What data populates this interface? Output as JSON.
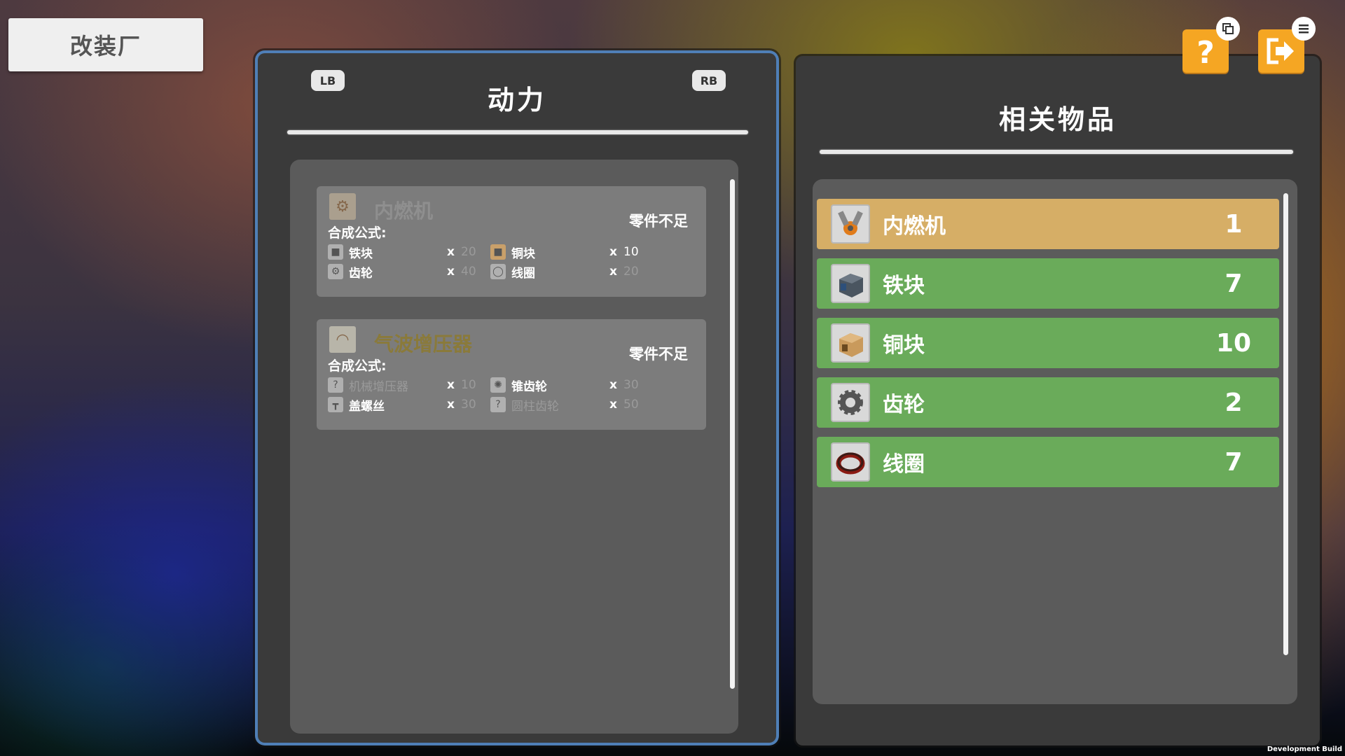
{
  "app": {
    "title": "改装厂"
  },
  "left_panel": {
    "prev_button": "LB",
    "next_button": "RB",
    "category": "动力",
    "recipes": [
      {
        "name": "内燃机",
        "status": "零件不足",
        "formula_label": "合成公式:",
        "ingredients": [
          {
            "name": "铁块",
            "x": "x",
            "qty": "20"
          },
          {
            "name": "铜块",
            "x": "x",
            "qty": "10"
          },
          {
            "name": "齿轮",
            "x": "x",
            "qty": "40"
          },
          {
            "name": "线圈",
            "x": "x",
            "qty": "20"
          }
        ]
      },
      {
        "name": "气波增压器",
        "status": "零件不足",
        "formula_label": "合成公式:",
        "ingredients": [
          {
            "name": "机械增压器",
            "x": "x",
            "qty": "10"
          },
          {
            "name": "锥齿轮",
            "x": "x",
            "qty": "30"
          },
          {
            "name": "盖螺丝",
            "x": "x",
            "qty": "30"
          },
          {
            "name": "圆柱齿轮",
            "x": "x",
            "qty": "50"
          }
        ]
      }
    ]
  },
  "right_panel": {
    "title": "相关物品",
    "items": [
      {
        "name": "内燃机",
        "count": "1",
        "icon": "engine-icon",
        "color": "#d6ae66"
      },
      {
        "name": "铁块",
        "count": "7",
        "icon": "iron-block-icon",
        "color": "#6aab5a"
      },
      {
        "name": "铜块",
        "count": "10",
        "icon": "copper-block-icon",
        "color": "#6aab5a"
      },
      {
        "name": "齿轮",
        "count": "2",
        "icon": "gear-icon",
        "color": "#6aab5a"
      },
      {
        "name": "线圈",
        "count": "7",
        "icon": "coil-icon",
        "color": "#6aab5a"
      }
    ]
  },
  "corner_buttons": {
    "help_icon": "question-icon",
    "exit_icon": "exit-icon"
  },
  "footer": {
    "build_label": "Development Build"
  },
  "colors": {
    "accent_orange": "#f5a623",
    "highlight_row": "#d6ae66",
    "owned_row": "#6aab5a",
    "rare_item_text": "#8a7a3a"
  }
}
